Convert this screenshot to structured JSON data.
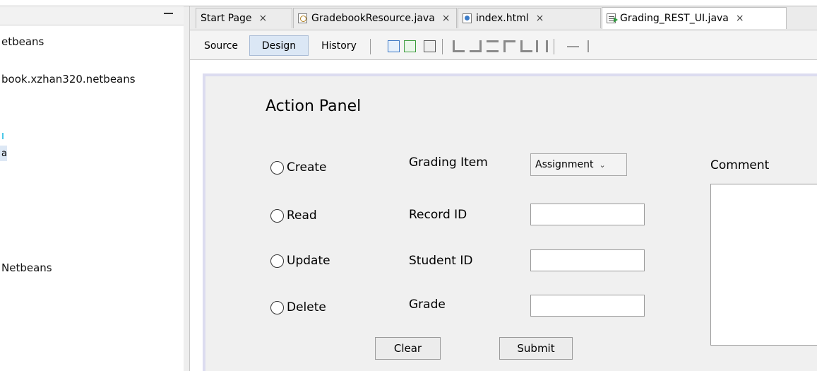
{
  "left_pane": {
    "items": [
      "etbeans",
      "book.xzhan320.netbeans",
      "a",
      "Netbeans"
    ]
  },
  "tabs": [
    {
      "label": "Start Page",
      "close": "×",
      "icon": ""
    },
    {
      "label": "GradebookResource.java",
      "close": "×",
      "icon": "java-file-icon"
    },
    {
      "label": "index.html",
      "close": "×",
      "icon": "html-file-icon"
    },
    {
      "label": "Grading_REST_UI.java",
      "close": "×",
      "icon": "form-file-icon",
      "active": true
    }
  ],
  "toolbar": {
    "source": "Source",
    "design": "Design",
    "history": "History",
    "active": "Design"
  },
  "form": {
    "title": "Action Panel",
    "radios": [
      "Create",
      "Read",
      "Update",
      "Delete"
    ],
    "labels": {
      "grading_item": "Grading Item",
      "record_id": "Record ID",
      "student_id": "Student ID",
      "grade": "Grade",
      "comment": "Comment"
    },
    "grading_item_selected": "Assignment",
    "buttons": {
      "clear": "Clear",
      "submit": "Submit"
    }
  },
  "colors": {
    "form_bg": "#f0f0f0",
    "form_border": "#dcdcf0",
    "active_toolbar": "#dbe7f5"
  }
}
